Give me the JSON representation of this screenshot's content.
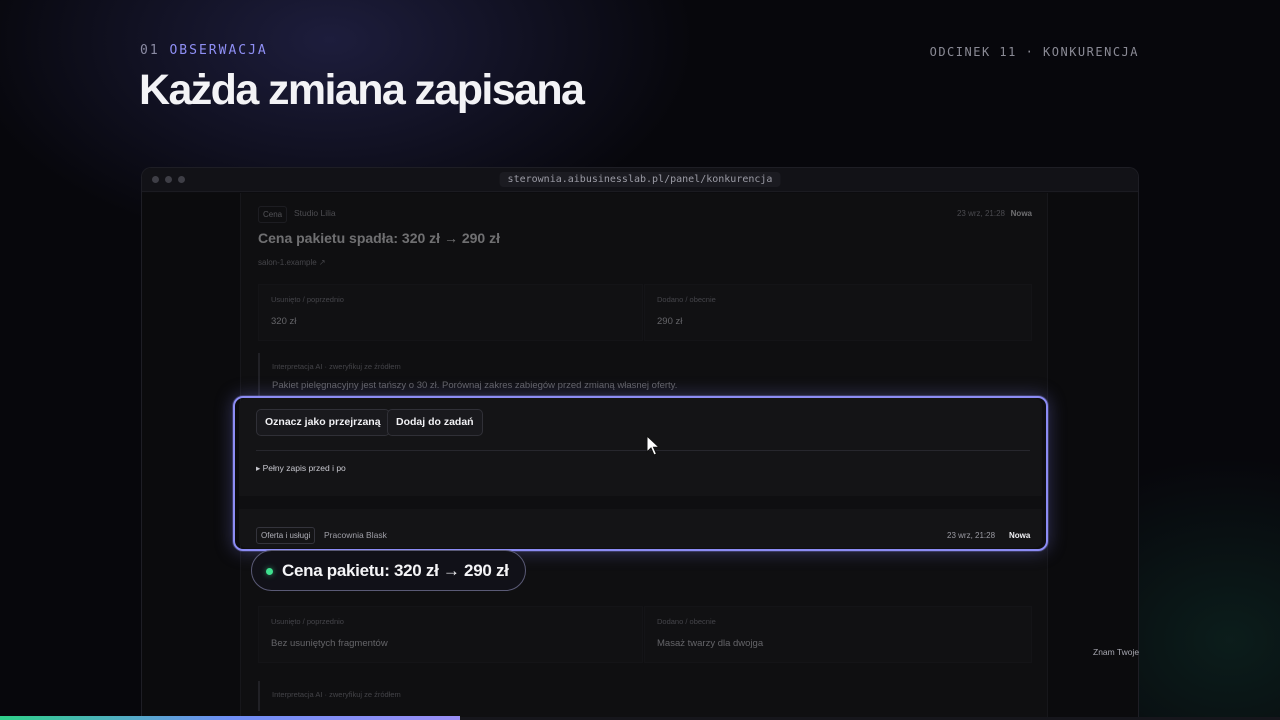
{
  "header": {
    "section_number": "01",
    "section_label": "OBSERWACJA",
    "episode": "ODCINEK 11 · KONKURENCJA",
    "title": "Każda zmiana zapisana"
  },
  "browser": {
    "url": "sterownia.aibusinesslab.pl/panel/konkurencja"
  },
  "entry1": {
    "tag": "Cena",
    "source": "Studio Lilia",
    "timestamp": "23 wrz, 21:28",
    "status": "Nowa",
    "title": "Cena pakietu spadła: 320 zł → 290 zł",
    "domain": "salon-1.example ↗",
    "removed_label": "Usunięto / poprzednio",
    "removed_value": "320 zł",
    "added_label": "Dodano / obecnie",
    "added_value": "290 zł",
    "interp_label": "Interpretacja AI · zweryfikuj ze źródłem",
    "interp_text": "Pakiet pielęgnacyjny jest tańszy o 30 zł. Porównaj zakres zabiegów przed zmianą własnej oferty.",
    "mark_reviewed_button": "Oznacz jako przejrzaną",
    "add_task_button": "Dodaj do zadań",
    "details_toggle": "▸ Pełny zapis przed i po"
  },
  "entry2": {
    "tag": "Oferta i usługi",
    "source": "Pracownia Blask",
    "timestamp": "23 wrz, 21:28",
    "status": "Nowa",
    "removed_label": "Usunięto / poprzednio",
    "removed_value": "Bez usuniętych fragmentów",
    "added_label": "Dodano / obecnie",
    "added_value": "Masaż twarzy dla dwojga",
    "interp_label": "Interpretacja AI · zweryfikuj ze źródłem"
  },
  "callout": {
    "text": "Cena pakietu: 320 zł → 290 zł",
    "dot_color": "#3fe08f"
  },
  "side_text": "Znam Twoje",
  "colors": {
    "accent": "#8c8cf4",
    "success": "#3fe08f",
    "background": "#07070c"
  }
}
